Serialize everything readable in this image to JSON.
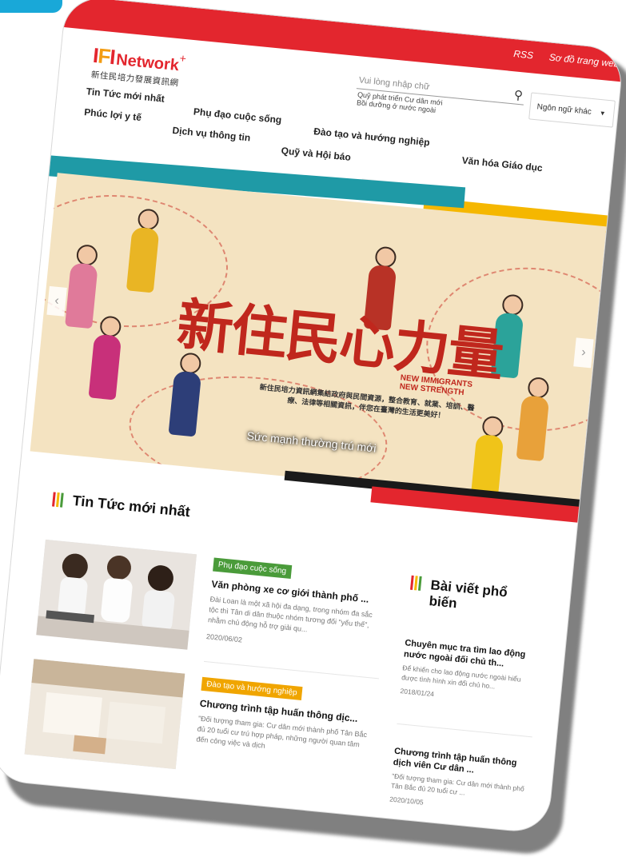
{
  "header": {
    "links": [
      "RSS",
      "Sơ đồ trang web"
    ],
    "logo": {
      "mark_left": "I",
      "mark_mid": "F",
      "mark_right": "I",
      "word": "Network",
      "plus": "+",
      "sub": "新住民培力發展資訊網"
    }
  },
  "search": {
    "placeholder": "Vui lòng nhập chữ",
    "suggestions": [
      "Quỹ phát triển Cư dân mới",
      "Bồi dưỡng ở nước ngoài"
    ]
  },
  "language": {
    "label": "Ngôn ngữ khác"
  },
  "nav": [
    "Tin Tức mới nhất",
    "Phụ đạo cuộc sống",
    "Đào tạo và hướng nghiệp",
    "Văn hóa Giáo dục",
    "Phúc lợi y tế",
    "Dịch vụ thông tin",
    "Quỹ và Hội báo"
  ],
  "banner": {
    "title_zh": "新住民心力量",
    "title_en_1": "NEW IMMIGRANTS",
    "title_en_2": "NEW STRENGTH",
    "desc_zh": "新住民培力資訊網集結政府與民間資源，整合教育、就業、培訓、醫療、法律等相關資訊，伴您在臺灣的生活更美好！",
    "caption": "Sức mạnh thường trú mới",
    "prev": "‹",
    "next": "›"
  },
  "latest": {
    "title": "Tin Tức mới nhất",
    "items": [
      {
        "tag": "Phụ đạo cuộc sống",
        "tag_color": "#4a9b3a",
        "headline": "Văn phòng xe cơ giới thành phố ...",
        "excerpt": "Đài Loan là một xã hội đa dạng, trong nhóm đa sắc tộc thì Tân di dân thuộc nhóm tương đối \"yếu thế\", nhằm chủ động hỗ trợ giải qu...",
        "date": "2020/06/02"
      },
      {
        "tag": "Đào tạo và hướng nghiệp",
        "tag_color": "#f0a500",
        "headline": "Chương trình tập huấn thông dịc...",
        "excerpt": "\"Đối tượng tham gia: Cư dân mới thành phố Tân Bắc đủ 20 tuổi cư trú hợp pháp, những người quan tâm đến công việc và dịch",
        "date": ""
      }
    ]
  },
  "popular": {
    "title": "Bài viết phổ biến",
    "items": [
      {
        "headline": "Chuyên mục tra tìm lao động nước ngoài đối chủ th...",
        "excerpt": "Để khiến cho lao động nước ngoài hiểu được tình hình xin đổi chủ ho...",
        "date": "2018/01/24"
      },
      {
        "headline": "Chương trình tập huấn thông dịch viên Cư dân ...",
        "excerpt": "\"Đối tượng tham gia: Cư dân mới thành phố Tân Bắc đủ 20 tuổi cư ...",
        "date": "2020/10/05"
      }
    ]
  },
  "colors": {
    "brand_red": "#e3262e",
    "teal": "#1f9aa6",
    "yellow": "#f5b700",
    "bar_colors": [
      "#e3262e",
      "#f5b700",
      "#4a9b3a"
    ]
  }
}
